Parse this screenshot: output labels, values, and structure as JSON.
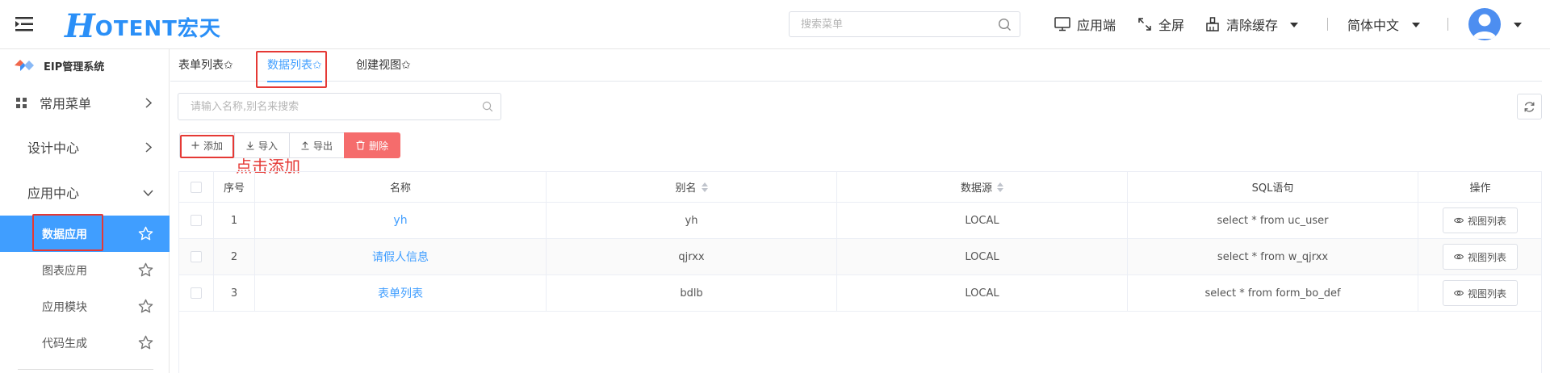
{
  "header": {
    "logo_h": "H",
    "logo_rest": "OTENT宏天",
    "search_placeholder": "搜索菜单",
    "app_side": "应用端",
    "fullscreen": "全屏",
    "clear_cache": "清除缓存",
    "language": "简体中文",
    "brand_color": "#2a8ff7"
  },
  "sidebar": {
    "system_title": "EIP管理系统",
    "menus": [
      {
        "label": "常用菜单"
      },
      {
        "label": "设计中心"
      },
      {
        "label": "应用中心"
      }
    ],
    "sub_items": [
      {
        "label": "数据应用",
        "active": true
      },
      {
        "label": "图表应用"
      },
      {
        "label": "应用模块"
      },
      {
        "label": "代码生成"
      }
    ],
    "active_color": "#409eff"
  },
  "tabs": [
    {
      "label": "表单列表✩"
    },
    {
      "label": "数据列表✩",
      "active": true
    },
    {
      "label": "创建视图✩"
    }
  ],
  "main": {
    "search_placeholder": "请输入名称,别名来搜索",
    "buttons": {
      "add": "添加",
      "import": "导入",
      "export": "导出",
      "delete": "删除"
    },
    "hint": "点击添加",
    "danger_color": "#f56c6c"
  },
  "table": {
    "columns": [
      "序号",
      "名称",
      "别名",
      "数据源",
      "SQL语句",
      "操作"
    ],
    "rows": [
      {
        "index": "1",
        "name": "yh",
        "alias": "yh",
        "source": "LOCAL",
        "sql": "select * from uc_user",
        "action": "视图列表"
      },
      {
        "index": "2",
        "name": "请假人信息",
        "alias": "qjrxx",
        "source": "LOCAL",
        "sql": "select * from w_qjrxx",
        "action": "视图列表"
      },
      {
        "index": "3",
        "name": "表单列表",
        "alias": "bdlb",
        "source": "LOCAL",
        "sql": "select * from form_bo_def",
        "action": "视图列表"
      }
    ]
  }
}
